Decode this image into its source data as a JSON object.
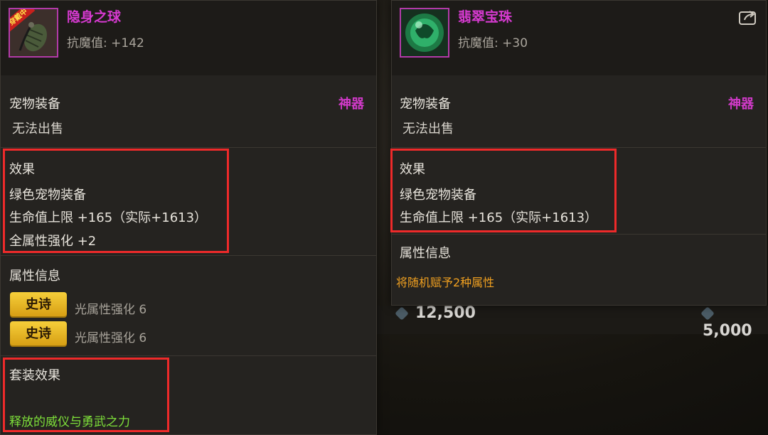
{
  "left_card": {
    "item_name": "隐身之球",
    "equip_tag": "穿戴中",
    "stat_line": "抗魔值: +142",
    "category": "宠物装备",
    "rarity": "神器",
    "sell_note": "无法出售",
    "effect_title": "效果",
    "effect_lines": [
      "绿色宠物装备",
      "生命值上限 +165（实际+1613）",
      "全属性强化 +2"
    ],
    "attr_title": "属性信息",
    "attrs": [
      {
        "badge": "史诗",
        "text": "光属性强化 6"
      },
      {
        "badge": "史诗",
        "text": "光属性强化 6"
      }
    ],
    "set_title": "套装效果",
    "set_text": "释放的威仪与勇武之力"
  },
  "right_card": {
    "item_name": "翡翠宝珠",
    "stat_line": "抗魔值: +30",
    "category": "宠物装备",
    "rarity": "神器",
    "sell_note": "无法出售",
    "effect_title": "效果",
    "effect_lines": [
      "绿色宠物装备",
      "生命值上限 +165（实际+1613）"
    ],
    "attr_title": "属性信息",
    "attr_note": "将随机赋予2种属性"
  },
  "background": {
    "price_a": "12,500",
    "price_b": "5,000"
  },
  "colors": {
    "highlight": "#ee2a2a",
    "rarity": "#d03ac8",
    "green_text": "#7ee03a",
    "orange_text": "#f0a020",
    "badge": "#e8b523"
  }
}
